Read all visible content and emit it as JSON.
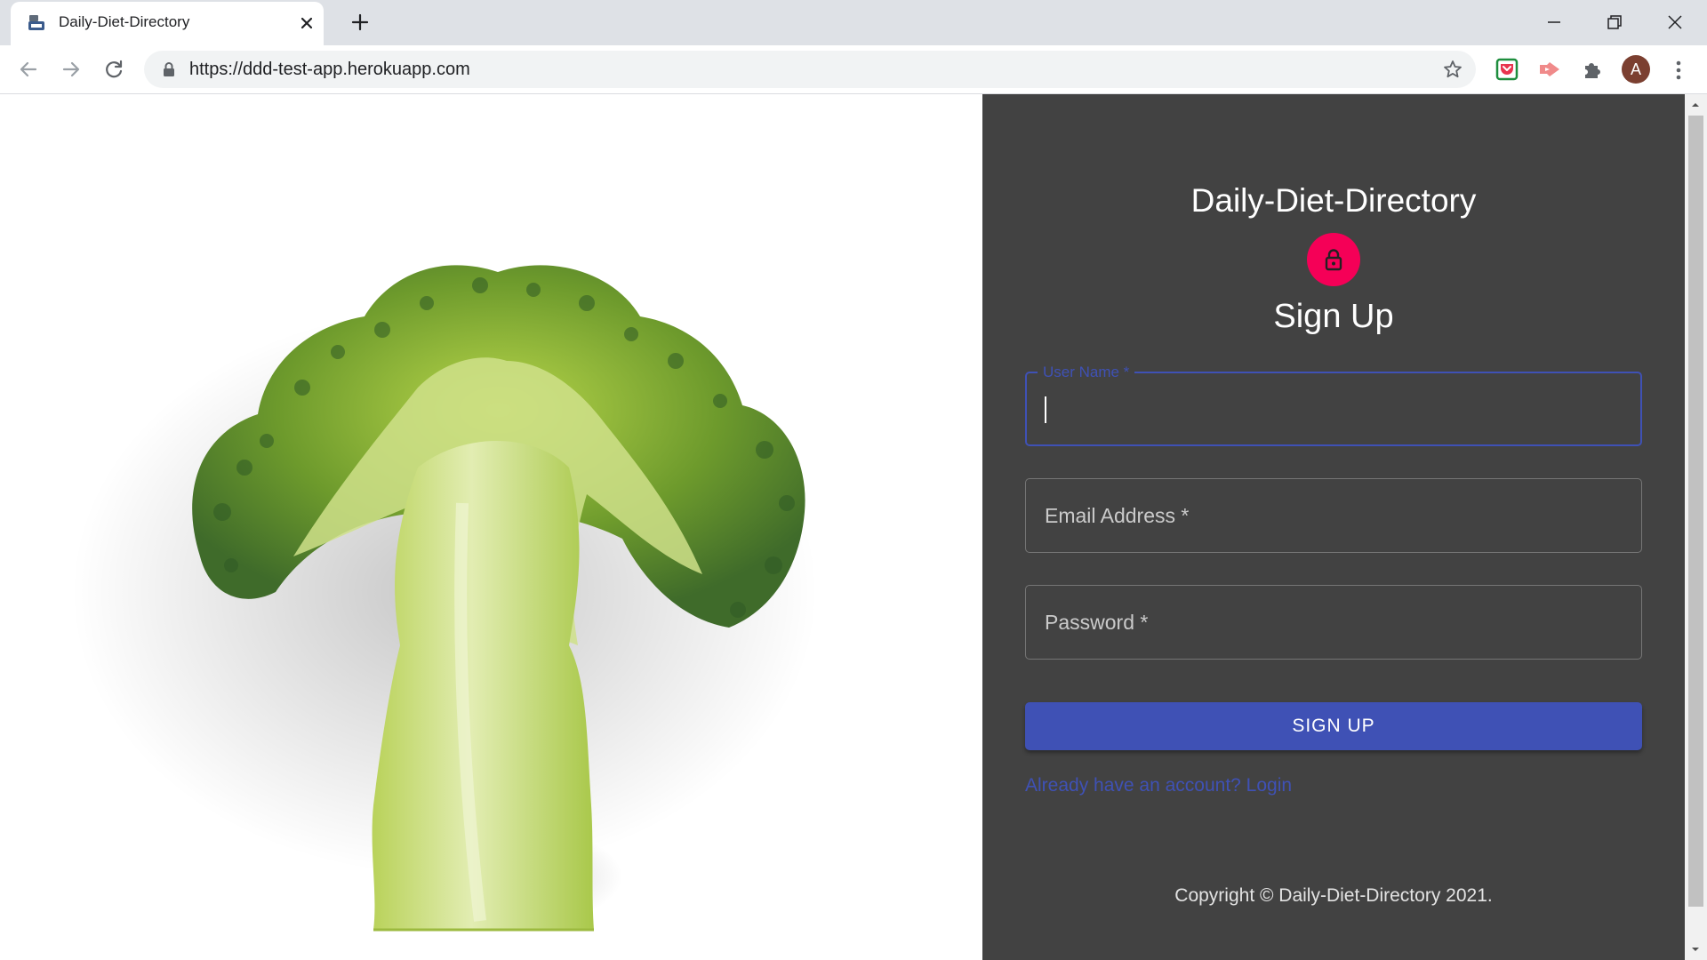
{
  "browser": {
    "tab_title": "Daily-Diet-Directory",
    "url": "https://ddd-test-app.herokuapp.com",
    "profile_initial": "A",
    "icons": [
      "favicon",
      "close-icon",
      "new-tab-icon",
      "minimize-icon",
      "restore-icon",
      "window-close-icon",
      "back-icon",
      "forward-icon",
      "reload-icon",
      "lock-icon",
      "star-icon",
      "pocket-icon",
      "cast-icon",
      "extensions-icon",
      "more-menu-icon"
    ]
  },
  "hero": {
    "image": "broccoli-cross-section"
  },
  "form": {
    "app_title": "Daily-Diet-Directory",
    "heading": "Sign Up",
    "username_label": "User Name *",
    "username_value": "",
    "email_label": "Email Address *",
    "password_label": "Password *",
    "submit_label": "SIGN UP",
    "login_link": "Already have an account? Login",
    "copyright": "Copyright © Daily-Diet-Directory 2021."
  },
  "colors": {
    "panel_bg": "#424242",
    "primary": "#3f51b5",
    "accent": "#f50057"
  }
}
